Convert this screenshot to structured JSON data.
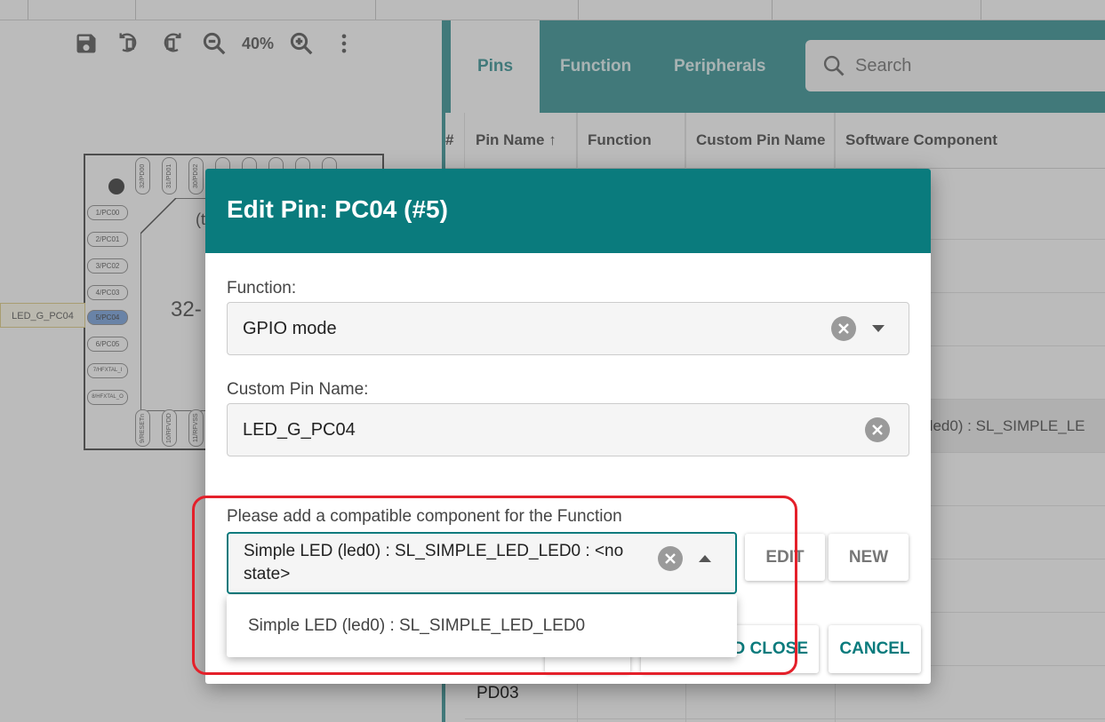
{
  "toolbar": {
    "zoom": "40%",
    "icons": [
      "save-icon",
      "rotate-left-icon",
      "rotate-right-icon",
      "zoom-out-icon",
      "zoom-in-icon",
      "more-vert-icon"
    ]
  },
  "chip": {
    "label_text": "(t",
    "body_text": "32-",
    "selected_pin_label": "LED_G_PC04",
    "left_pins": [
      "1/PC00",
      "2/PC01",
      "3/PC02",
      "4/PC03",
      "5/PC04",
      "6/PC05",
      "7/HFXTAL_I",
      "8/HFXTAL_O"
    ],
    "top_pins": [
      "32/PD00",
      "31/PD01",
      "30/PD02",
      "",
      "",
      "",
      "",
      ""
    ],
    "bottom_pins": [
      "9/RESETn",
      "10/RFVDD",
      "11/RFVSS"
    ]
  },
  "tabs": {
    "pins": "Pins",
    "function": "Function",
    "peripherals": "Peripherals"
  },
  "search": {
    "placeholder": "Search"
  },
  "table": {
    "headers": {
      "num": "#",
      "pin_name": "Pin Name ↑",
      "function": "Function",
      "custom_pin_name": "Custom Pin Name",
      "software_component": "Software Component"
    },
    "highlight_row_text": "(led0) : SL_SIMPLE_LE",
    "bottom_row_pin": "PD03"
  },
  "dialog": {
    "title": "Edit Pin: PC04 (#5)",
    "function_label": "Function:",
    "function_value": "GPIO mode",
    "custom_pin_label": "Custom Pin Name:",
    "custom_pin_value": "LED_G_PC04",
    "component_label": "Please add a compatible component for the Function",
    "component_value_line1": "Simple LED (led0) : SL_SIMPLE_LED_LED0 : <no",
    "component_value_line2": "state>",
    "edit_label": "EDIT",
    "new_label": "NEW",
    "save_close_label": "D CLOSE",
    "cancel_label": "CANCEL",
    "dropdown_option": "Simple LED (led0) : SL_SIMPLE_LED_LED0"
  },
  "colors": {
    "teal": "#0a7b7d",
    "highlight_red": "#e4202a",
    "selected_pin": "#5b8fd6"
  }
}
